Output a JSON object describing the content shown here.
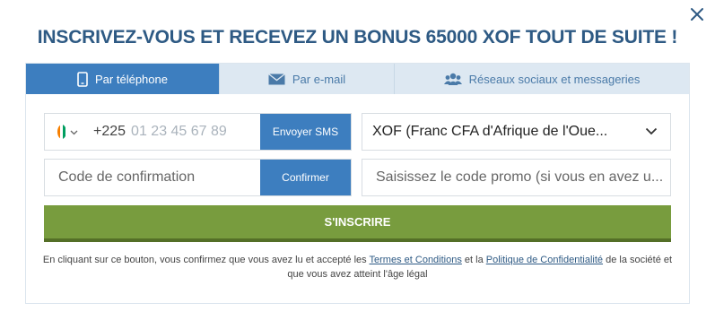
{
  "title": "INSCRIVEZ-VOUS ET RECEVEZ UN BONUS 65000 XOF TOUT DE SUITE !",
  "close_icon": "close-icon",
  "tabs": [
    {
      "label": "Par téléphone",
      "icon": "phone-icon",
      "active": true
    },
    {
      "label": "Par e-mail",
      "icon": "envelope-icon",
      "active": false
    },
    {
      "label": "Réseaux sociaux et messageries",
      "icon": "users-icon",
      "active": false
    }
  ],
  "phone": {
    "country_flag": "ivory-coast-flag",
    "dial_code": "+225",
    "placeholder": "01 23 45 67 89",
    "send_sms_label": "Envoyer SMS"
  },
  "currency": {
    "selected": "XOF (Franc CFA d'Afrique de l'Oue..."
  },
  "confirmation": {
    "placeholder": "Code de confirmation",
    "confirm_label": "Confirmer"
  },
  "promo": {
    "placeholder": "Saisissez le code promo (si vous en avez u..."
  },
  "submit_label": "S'INSCRIRE",
  "legal": {
    "text_1": "En cliquant sur ce bouton, vous confirmez que vous avez lu et accepté les ",
    "terms_link": "Termes et Conditions",
    "text_2": " et la ",
    "privacy_link": "Politique de Confidentialité",
    "text_3": " de la société et que vous avez atteint l'âge légal"
  },
  "colors": {
    "title": "#2e5a84",
    "tab_active": "#3d7ebf",
    "tab_inactive": "#dde8f2",
    "submit": "#789c3e",
    "flag": [
      "#f77f00",
      "#ffffff",
      "#009e60"
    ]
  }
}
